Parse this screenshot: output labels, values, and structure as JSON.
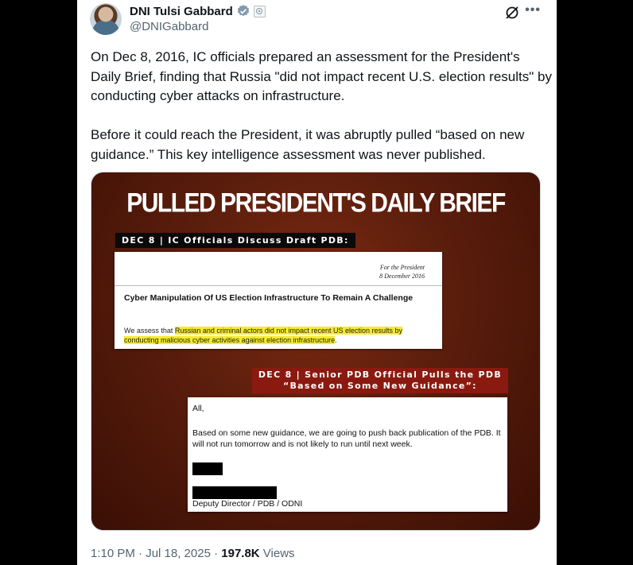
{
  "author": {
    "display_name": "DNI Tulsi Gabbard",
    "handle": "@DNIGabbard"
  },
  "icons": {
    "verified": "verified-badge-icon",
    "affiliation": "government-affiliation-icon",
    "grok": "grok-icon",
    "more": "more-icon"
  },
  "tweet": {
    "text": "On Dec 8, 2016, IC officials prepared an assessment for the President's Daily Brief, finding that Russia \"did not impact recent U.S. election results\" by conducting cyber attacks on infrastructure.\n\nBefore it could reach the President, it was abruptly pulled “based on new guidance.” This key intelligence assessment was never published."
  },
  "media": {
    "title": "PULLED PRESIDENT'S DAILY BRIEF",
    "tag1": "DEC 8 | IC Officials Discuss Draft PDB:",
    "doc1": {
      "meta_line1": "For the President",
      "meta_line2": "8 December 2016",
      "heading": "Cyber Manipulation Of US Election Infrastructure To Remain A Challenge",
      "body_prefix": "We assess that ",
      "body_highlight": "Russian and criminal actors did not impact recent US election results by conducting malicious cyber activities against election infrastructure",
      "body_suffix": "."
    },
    "tag2_line1": "DEC 8 | Senior PDB Official Pulls the PDB",
    "tag2_line2": "“Based on Some New Guidance”:",
    "doc2": {
      "salutation": "All,",
      "message": "Based on some new guidance, we are going to push back publication of the PDB. It will not run tomorrow and is not likely to run until next week.",
      "signature": "Deputy Director / PDB / ODNI"
    }
  },
  "footer": {
    "time": "1:10 PM · Jul 18, 2025 · ",
    "views_count": "197.8K",
    "views_label": " Views"
  }
}
